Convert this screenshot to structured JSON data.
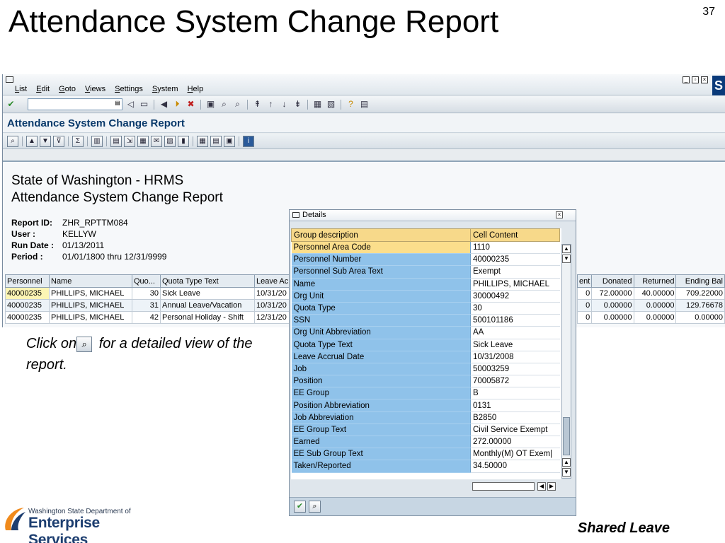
{
  "slide": {
    "title": "Attendance System Change Report",
    "page_number": "37",
    "click_note_prefix": "Click on",
    "click_note_suffix": "for a detailed view of the report.",
    "footer_right": "Shared Leave"
  },
  "logo": {
    "line1": "Washington State Department of",
    "line2": "Enterprise Services"
  },
  "sap": {
    "menu": [
      "List",
      "Edit",
      "Goto",
      "Views",
      "Settings",
      "System",
      "Help"
    ],
    "app_title": "Attendance System Change Report",
    "report_heading1": "State of Washington - HRMS",
    "report_heading2": "Attendance System Change Report",
    "meta": [
      {
        "label": "Report ID:",
        "value": "ZHR_RPTTM084"
      },
      {
        "label": "User :",
        "value": "KELLYW"
      },
      {
        "label": "Run Date :",
        "value": "01/13/2011"
      },
      {
        "label": "Period :",
        "value": "01/01/1800 thru 12/31/9999"
      }
    ],
    "grid_left": {
      "headers": [
        "Personnel",
        "Name",
        "Quo...",
        "Quota Type Text",
        "Leave Ac"
      ],
      "rows": [
        [
          "40000235",
          "PHILLIPS, MICHAEL",
          "30",
          "Sick Leave",
          "10/31/20"
        ],
        [
          "40000235",
          "PHILLIPS, MICHAEL",
          "31",
          "Annual Leave/Vacation",
          "10/31/20"
        ],
        [
          "40000235",
          "PHILLIPS, MICHAEL",
          "42",
          "Personal Holiday - Shift",
          "12/31/20"
        ]
      ]
    },
    "grid_right": {
      "headers": [
        "ent",
        "Donated",
        "Returned",
        "Ending Bal"
      ],
      "rows": [
        [
          "0",
          "72.00000",
          "40.00000",
          "709.22000"
        ],
        [
          "0",
          "0.00000",
          "0.00000",
          "129.76678"
        ],
        [
          "0",
          "0.00000",
          "0.00000",
          "0.00000"
        ]
      ]
    }
  },
  "details": {
    "title": "Details",
    "col_group": "Group description",
    "col_content": "Cell Content",
    "rows": [
      {
        "group": "Personnel Area Code",
        "value": "1110"
      },
      {
        "group": "Personnel Number",
        "value": "40000235"
      },
      {
        "group": "Personnel Sub Area Text",
        "value": "Exempt"
      },
      {
        "group": "Name",
        "value": "PHILLIPS, MICHAEL"
      },
      {
        "group": "Org Unit",
        "value": "30000492"
      },
      {
        "group": "Quota Type",
        "value": "30"
      },
      {
        "group": "SSN",
        "value": "500101186"
      },
      {
        "group": "Org Unit Abbreviation",
        "value": "AA"
      },
      {
        "group": "Quota Type Text",
        "value": "Sick Leave"
      },
      {
        "group": "Leave Accrual Date",
        "value": "10/31/2008"
      },
      {
        "group": "Job",
        "value": "50003259"
      },
      {
        "group": "Position",
        "value": "70005872"
      },
      {
        "group": "EE Group",
        "value": "B"
      },
      {
        "group": "Position Abbreviation",
        "value": "0131"
      },
      {
        "group": "Job Abbreviation",
        "value": "B2850"
      },
      {
        "group": "EE Group Text",
        "value": "Civil Service Exempt"
      },
      {
        "group": "Earned",
        "value": "272.00000"
      },
      {
        "group": "EE Sub Group Text",
        "value": "Monthly(M) OT Exem|"
      },
      {
        "group": "Taken/Reported",
        "value": "34.50000"
      }
    ]
  }
}
